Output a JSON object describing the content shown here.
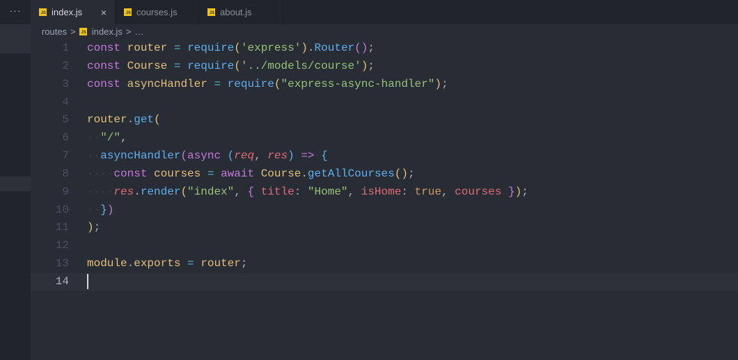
{
  "sidebar": {
    "more_label": "···"
  },
  "tabs": [
    {
      "label": "index.js",
      "active": true,
      "close": "×"
    },
    {
      "label": "courses.js"
    },
    {
      "label": "about.js"
    }
  ],
  "breadcrumb": {
    "folder": "routes",
    "sep": ">",
    "file": "index.js",
    "more": "…"
  },
  "editor": {
    "current_line": 14,
    "lines": [
      [
        [
          "const",
          "kw"
        ],
        [
          " ",
          "pl"
        ],
        [
          "router",
          "var"
        ],
        [
          " ",
          "pl"
        ],
        [
          "=",
          "op"
        ],
        [
          " ",
          "pl"
        ],
        [
          "require",
          "fn"
        ],
        [
          "(",
          "b1"
        ],
        [
          "'express'",
          "str"
        ],
        [
          ")",
          "b1"
        ],
        [
          ".",
          "pl"
        ],
        [
          "Router",
          "fn"
        ],
        [
          "(",
          "b2"
        ],
        [
          ")",
          "b2"
        ],
        [
          ";",
          "pl"
        ]
      ],
      [
        [
          "const",
          "kw"
        ],
        [
          " ",
          "pl"
        ],
        [
          "Course",
          "var"
        ],
        [
          " ",
          "pl"
        ],
        [
          "=",
          "op"
        ],
        [
          " ",
          "pl"
        ],
        [
          "require",
          "fn"
        ],
        [
          "(",
          "b1"
        ],
        [
          "'../models/course'",
          "str"
        ],
        [
          ")",
          "b1"
        ],
        [
          ";",
          "pl"
        ]
      ],
      [
        [
          "const",
          "kw"
        ],
        [
          " ",
          "pl"
        ],
        [
          "asyncHandler",
          "var"
        ],
        [
          " ",
          "pl"
        ],
        [
          "=",
          "op"
        ],
        [
          " ",
          "pl"
        ],
        [
          "require",
          "fn"
        ],
        [
          "(",
          "b1"
        ],
        [
          "\"express-async-handler\"",
          "str"
        ],
        [
          ")",
          "b1"
        ],
        [
          ";",
          "pl"
        ]
      ],
      [],
      [
        [
          "router",
          "var"
        ],
        [
          ".",
          "pl"
        ],
        [
          "get",
          "fn"
        ],
        [
          "(",
          "b1"
        ]
      ],
      [
        [
          "··",
          "ws"
        ],
        [
          "\"/\"",
          "str"
        ],
        [
          ",",
          "pl"
        ]
      ],
      [
        [
          "··",
          "ws"
        ],
        [
          "asyncHandler",
          "fn"
        ],
        [
          "(",
          "b2"
        ],
        [
          "async",
          "kw"
        ],
        [
          " ",
          "pl"
        ],
        [
          "(",
          "b3"
        ],
        [
          "req",
          "param"
        ],
        [
          ", ",
          "pl"
        ],
        [
          "res",
          "param"
        ],
        [
          ")",
          "b3"
        ],
        [
          " ",
          "pl"
        ],
        [
          "=>",
          "kw"
        ],
        [
          " ",
          "pl"
        ],
        [
          "{",
          "b3"
        ]
      ],
      [
        [
          "····",
          "ws"
        ],
        [
          "const",
          "kw"
        ],
        [
          " ",
          "pl"
        ],
        [
          "courses",
          "var"
        ],
        [
          " ",
          "pl"
        ],
        [
          "=",
          "op"
        ],
        [
          " ",
          "pl"
        ],
        [
          "await",
          "kw"
        ],
        [
          " ",
          "pl"
        ],
        [
          "Course",
          "var"
        ],
        [
          ".",
          "pl"
        ],
        [
          "getAllCourses",
          "fn"
        ],
        [
          "(",
          "b1"
        ],
        [
          ")",
          "b1"
        ],
        [
          ";",
          "pl"
        ]
      ],
      [
        [
          "····",
          "ws"
        ],
        [
          "res",
          "param"
        ],
        [
          ".",
          "pl"
        ],
        [
          "render",
          "fn"
        ],
        [
          "(",
          "b1"
        ],
        [
          "\"index\"",
          "str"
        ],
        [
          ", ",
          "pl"
        ],
        [
          "{",
          "b2"
        ],
        [
          " ",
          "pl"
        ],
        [
          "title",
          "prop"
        ],
        [
          ": ",
          "pl"
        ],
        [
          "\"Home\"",
          "str"
        ],
        [
          ", ",
          "pl"
        ],
        [
          "isHome",
          "prop"
        ],
        [
          ": ",
          "pl"
        ],
        [
          "true",
          "bool"
        ],
        [
          ", ",
          "pl"
        ],
        [
          "courses",
          "prop"
        ],
        [
          " ",
          "pl"
        ],
        [
          "}",
          "b2"
        ],
        [
          ")",
          "b1"
        ],
        [
          ";",
          "pl"
        ]
      ],
      [
        [
          "··",
          "ws"
        ],
        [
          "}",
          "b3"
        ],
        [
          ")",
          "b2"
        ]
      ],
      [
        [
          ")",
          "b1"
        ],
        [
          ";",
          "pl"
        ]
      ],
      [],
      [
        [
          "module",
          "var"
        ],
        [
          ".",
          "pl"
        ],
        [
          "exports",
          "var"
        ],
        [
          " ",
          "pl"
        ],
        [
          "=",
          "op"
        ],
        [
          " ",
          "pl"
        ],
        [
          "router",
          "var"
        ],
        [
          ";",
          "pl"
        ]
      ],
      []
    ]
  }
}
